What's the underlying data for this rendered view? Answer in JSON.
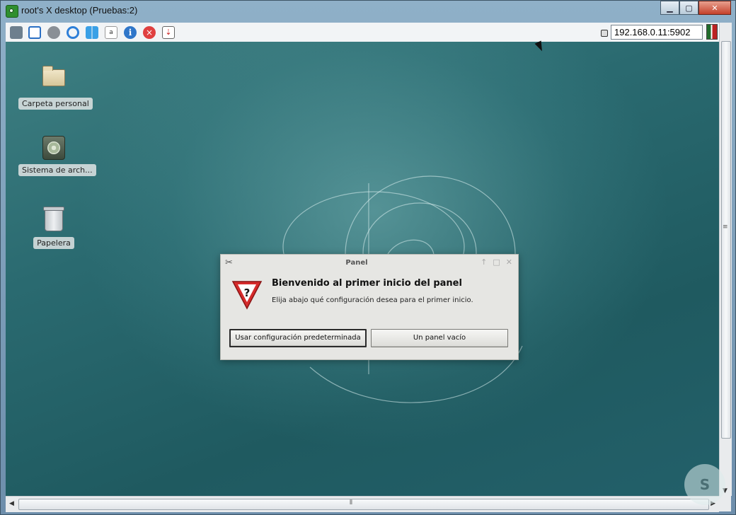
{
  "window": {
    "title": "root's X desktop (Pruebas:2)",
    "controls": [
      "minimize",
      "maximize",
      "close"
    ]
  },
  "toolbar": {
    "icons": [
      "connection-options-icon",
      "fullscreen-icon",
      "settings-icon",
      "refresh-icon",
      "windows-key-icon",
      "send-keys-icon",
      "info-icon",
      "disconnect-icon",
      "file-transfer-icon"
    ],
    "keys_label": "a",
    "info_glyph": "i",
    "disconnect_glyph": "×",
    "transfer_glyph": "⇣",
    "address": "192.168.0.11:5902"
  },
  "desktop": {
    "icons": [
      {
        "label": "Carpeta personal"
      },
      {
        "label": "Sistema de arch..."
      },
      {
        "label": "Papelera"
      }
    ]
  },
  "dialog": {
    "title": "Panel",
    "title_controls": [
      "↑",
      "□",
      "✕"
    ],
    "heading": "Bienvenido al primer inicio del panel",
    "message": "Elija abajo qué configuración desea para el primer inicio.",
    "buttons": {
      "default_label": "Usar configuración predeterminada",
      "empty_label": "Un panel vacío"
    }
  },
  "colors": {
    "desktop_bg": "#2a6a70",
    "dialog_bg": "#e6e6e3",
    "warning_red": "#d52b2b"
  }
}
